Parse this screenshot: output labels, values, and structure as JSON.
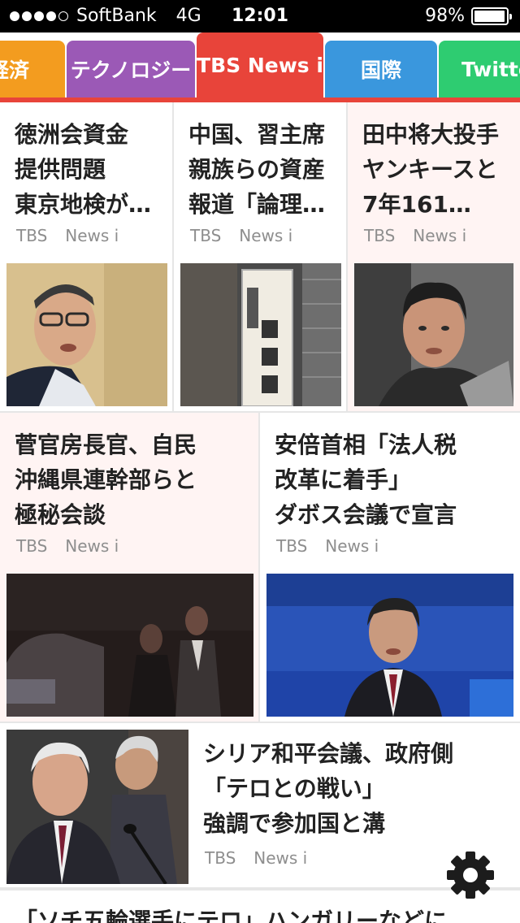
{
  "status_bar": {
    "carrier": "SoftBank",
    "network": "4G",
    "time": "12:01",
    "battery": "98%",
    "battery_level": 0.98,
    "signal_bars_filled": 4,
    "signal_bars_total": 5
  },
  "tabs": [
    {
      "label": "経済",
      "color": "#f39c1f"
    },
    {
      "label": "テクノロジー",
      "color": "#9b59b6"
    },
    {
      "label": "TBS News i",
      "color": "#e8443a",
      "active": true
    },
    {
      "label": "国際",
      "color": "#3a97dd"
    },
    {
      "label": "Twitte",
      "color": "#2ecc71"
    }
  ],
  "articles": [
    {
      "title_lines": [
        "徳洲会資金",
        "提供問題",
        "東京地検が…"
      ],
      "source": [
        "TBS",
        "News i"
      ],
      "image": "man-glasses-speaking-photo"
    },
    {
      "title_lines": [
        "中国、習主席",
        "親族らの資産",
        "報道「論理…"
      ],
      "source": [
        "TBS",
        "News i"
      ],
      "image": "foreign-ministry-sign-photo"
    },
    {
      "title_lines": [
        "田中将大投手",
        "ヤンキースと",
        "7年161…"
      ],
      "source": [
        "TBS",
        "News i"
      ],
      "image": "young-man-portrait-photo"
    },
    {
      "title_lines": [
        "菅官房長官、自民",
        "沖縄県連幹部らと",
        "極秘会談"
      ],
      "source": [
        "TBS",
        "News i"
      ],
      "image": "night-street-men-photo"
    },
    {
      "title_lines": [
        "安倍首相「法人税",
        "改革に着手」",
        "ダボス会議で宣言"
      ],
      "source": [
        "TBS",
        "News i"
      ],
      "image": "abe-davos-speech-photo"
    },
    {
      "title_lines": [
        "シリア和平会議、政府側",
        "「テロとの戦い」",
        "強調で参加国と溝"
      ],
      "source": [
        "TBS",
        "News i"
      ],
      "image": "syria-conference-photo"
    }
  ],
  "bottom_article": {
    "title": "「ソチ五輪選手にテロ」ハンガリーなどに"
  },
  "icons": {
    "settings": "gear-icon"
  }
}
